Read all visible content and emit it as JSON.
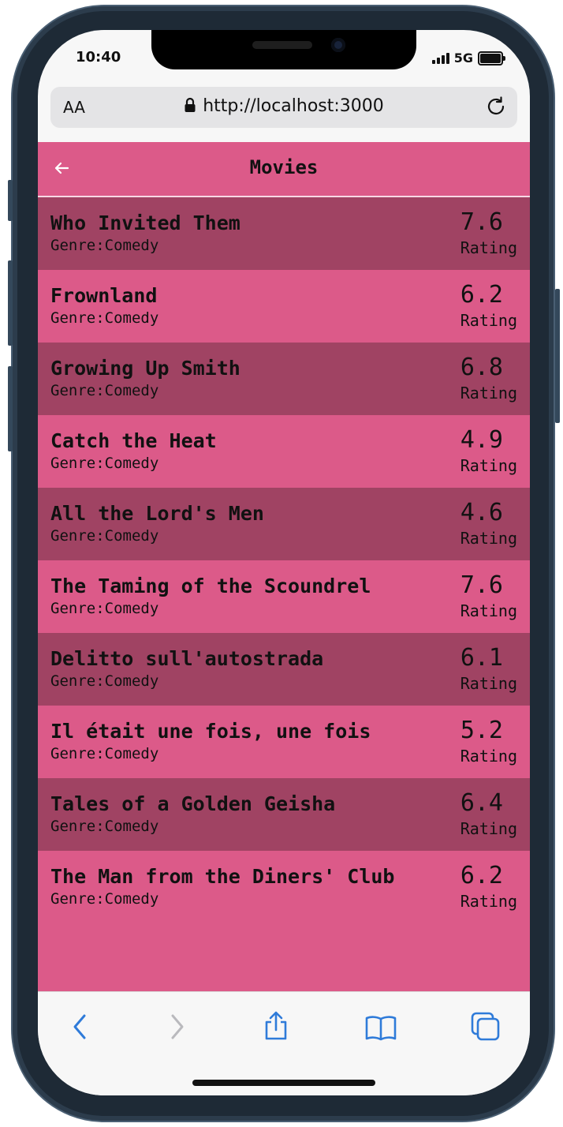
{
  "status_bar": {
    "time": "10:40",
    "network": "5G"
  },
  "browser": {
    "text_size_label": "AA",
    "url": "http://localhost:3000",
    "icons": [
      "lock-icon",
      "reload-icon"
    ]
  },
  "app": {
    "header_title": "Movies",
    "back_icon": "arrow-left-icon",
    "colors": {
      "primary": "#dc5a89",
      "row_dark": "#a04363"
    },
    "rating_label": "Rating",
    "movies": [
      {
        "title": "Who Invited Them",
        "genre": "Genre:Comedy",
        "rating": "7.6"
      },
      {
        "title": "Frownland",
        "genre": "Genre:Comedy",
        "rating": "6.2"
      },
      {
        "title": "Growing Up Smith",
        "genre": "Genre:Comedy",
        "rating": "6.8"
      },
      {
        "title": "Catch the Heat",
        "genre": "Genre:Comedy",
        "rating": "4.9"
      },
      {
        "title": "All the Lord's Men",
        "genre": "Genre:Comedy",
        "rating": "4.6"
      },
      {
        "title": "The Taming of the Scoundrel",
        "genre": "Genre:Comedy",
        "rating": "7.6"
      },
      {
        "title": "Delitto sull'autostrada",
        "genre": "Genre:Comedy",
        "rating": "6.1"
      },
      {
        "title": "Il était une fois, une fois",
        "genre": "Genre:Comedy",
        "rating": "5.2"
      },
      {
        "title": "Tales of a Golden Geisha",
        "genre": "Genre:Comedy",
        "rating": "6.4"
      },
      {
        "title": "The Man from the Diners' Club",
        "genre": "Genre:Comedy",
        "rating": "6.2"
      }
    ]
  },
  "toolbar": {
    "icons": [
      "back-chevron-icon",
      "forward-chevron-icon",
      "share-icon",
      "bookmarks-icon",
      "tabs-icon"
    ],
    "accent_color": "#2f7bd9"
  }
}
